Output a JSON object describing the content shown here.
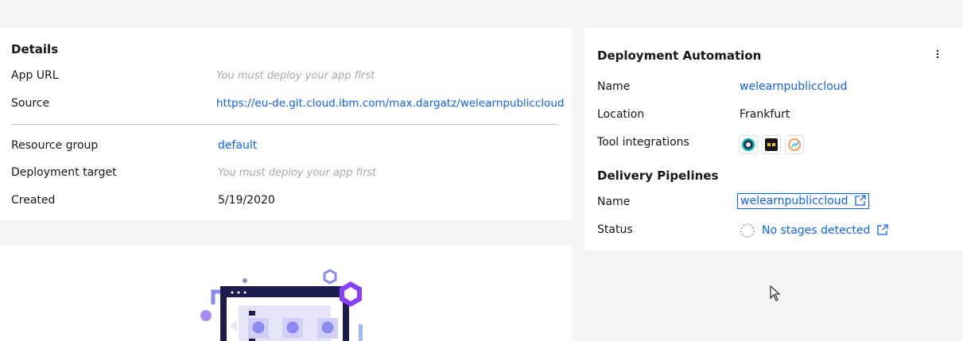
{
  "details": {
    "title": "Details",
    "rows": [
      {
        "label": "App URL",
        "value": "You must deploy your app first"
      },
      {
        "label": "Source",
        "value": "https://eu-de.git.cloud.ibm.com/max.dargatz/welearnpubliccloud"
      },
      {
        "label": "Resource group",
        "value": "default"
      },
      {
        "label": "Deployment target",
        "value": "You must deploy your app first"
      },
      {
        "label": "Created",
        "value": "5/19/2020"
      }
    ]
  },
  "automation": {
    "title": "Deployment Automation",
    "name_label": "Name",
    "name_value": "welearnpubliccloud",
    "location_label": "Location",
    "location_value": "Frankfurt",
    "tools_label": "Tool integrations",
    "tools": [
      "circular-tool-icon",
      "dark-tool-icon",
      "gauge-tool-icon"
    ],
    "pipelines_title": "Delivery Pipelines",
    "pipeline_name_label": "Name",
    "pipeline_name_value": "welearnpubliccloud",
    "status_label": "Status",
    "status_value": "No stages detected"
  },
  "colors": {
    "accent": "#0f62fe",
    "illustration_primary": "#8a3ffc",
    "illustration_dark": "#1c1c4f",
    "illustration_soft": "#a6c8ff"
  }
}
